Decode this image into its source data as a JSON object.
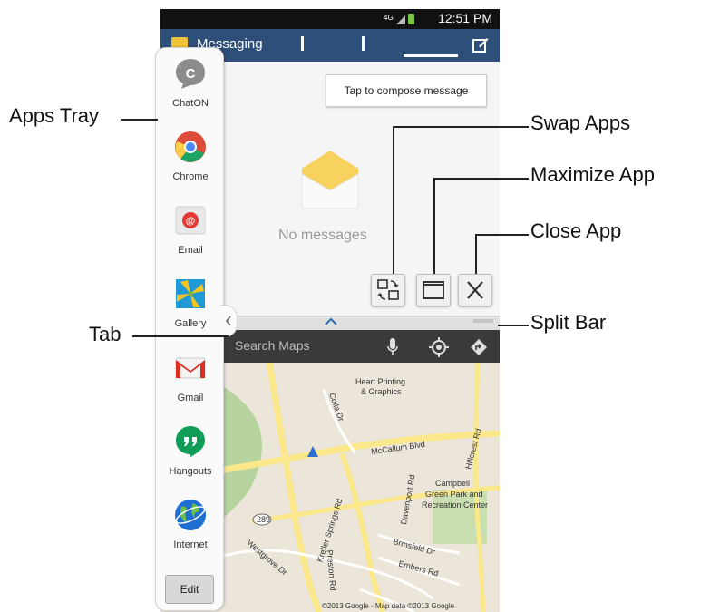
{
  "status_bar": {
    "network": "4G",
    "time": "12:51 PM"
  },
  "messaging": {
    "title": "Messaging",
    "compose_tooltip": "Tap to compose message",
    "empty_text": "No messages"
  },
  "window_controls": {
    "swap_icon": "swap-apps-icon",
    "maximize_icon": "maximize-icon",
    "close_icon": "close-icon"
  },
  "maps": {
    "search_placeholder": "Search Maps",
    "labels": {
      "heart_printing": "Heart Printing",
      "graphics": "& Graphics",
      "colla_dr": "Colla Dr",
      "mccallum": "McCallum Blvd",
      "hillcrest": "Hillcrest Rd",
      "davenport": "Davenport Rd",
      "campbell": "Campbell",
      "green_park": "Green Park and",
      "recreation": "Recreation Center",
      "kreuter": "Kreller Springs Rd",
      "route": "289",
      "westgrove": "Westgrove Dr",
      "preston": "Preston Rd",
      "brookfield": "Brmsfeld Dr",
      "embers": "Embers Rd",
      "copyright": "©2013 Google - Map data ©2013 Google"
    }
  },
  "tray": {
    "apps": [
      {
        "label": "ChatON",
        "icon": "chaton-icon",
        "color": "#8c8c8c"
      },
      {
        "label": "Chrome",
        "icon": "chrome-icon",
        "color": "#dd4b39"
      },
      {
        "label": "Email",
        "icon": "email-icon",
        "color": "#e53935"
      },
      {
        "label": "Gallery",
        "icon": "gallery-icon",
        "color": "#f7c51e"
      },
      {
        "label": "Gmail",
        "icon": "gmail-icon",
        "color": "#d93025"
      },
      {
        "label": "Hangouts",
        "icon": "hangouts-icon",
        "color": "#0f9d58"
      },
      {
        "label": "Internet",
        "icon": "internet-icon",
        "color": "#1e6fd1"
      }
    ],
    "edit_label": "Edit"
  },
  "callouts": {
    "apps_tray": "Apps Tray",
    "swap_apps": "Swap Apps",
    "maximize_app": "Maximize App",
    "close_app": "Close App",
    "tab": "Tab",
    "split_bar": "Split Bar"
  },
  "colors": {
    "action_bar": "#2d4f7a",
    "map_green": "#b7d39e",
    "map_road": "#fbe88a"
  }
}
